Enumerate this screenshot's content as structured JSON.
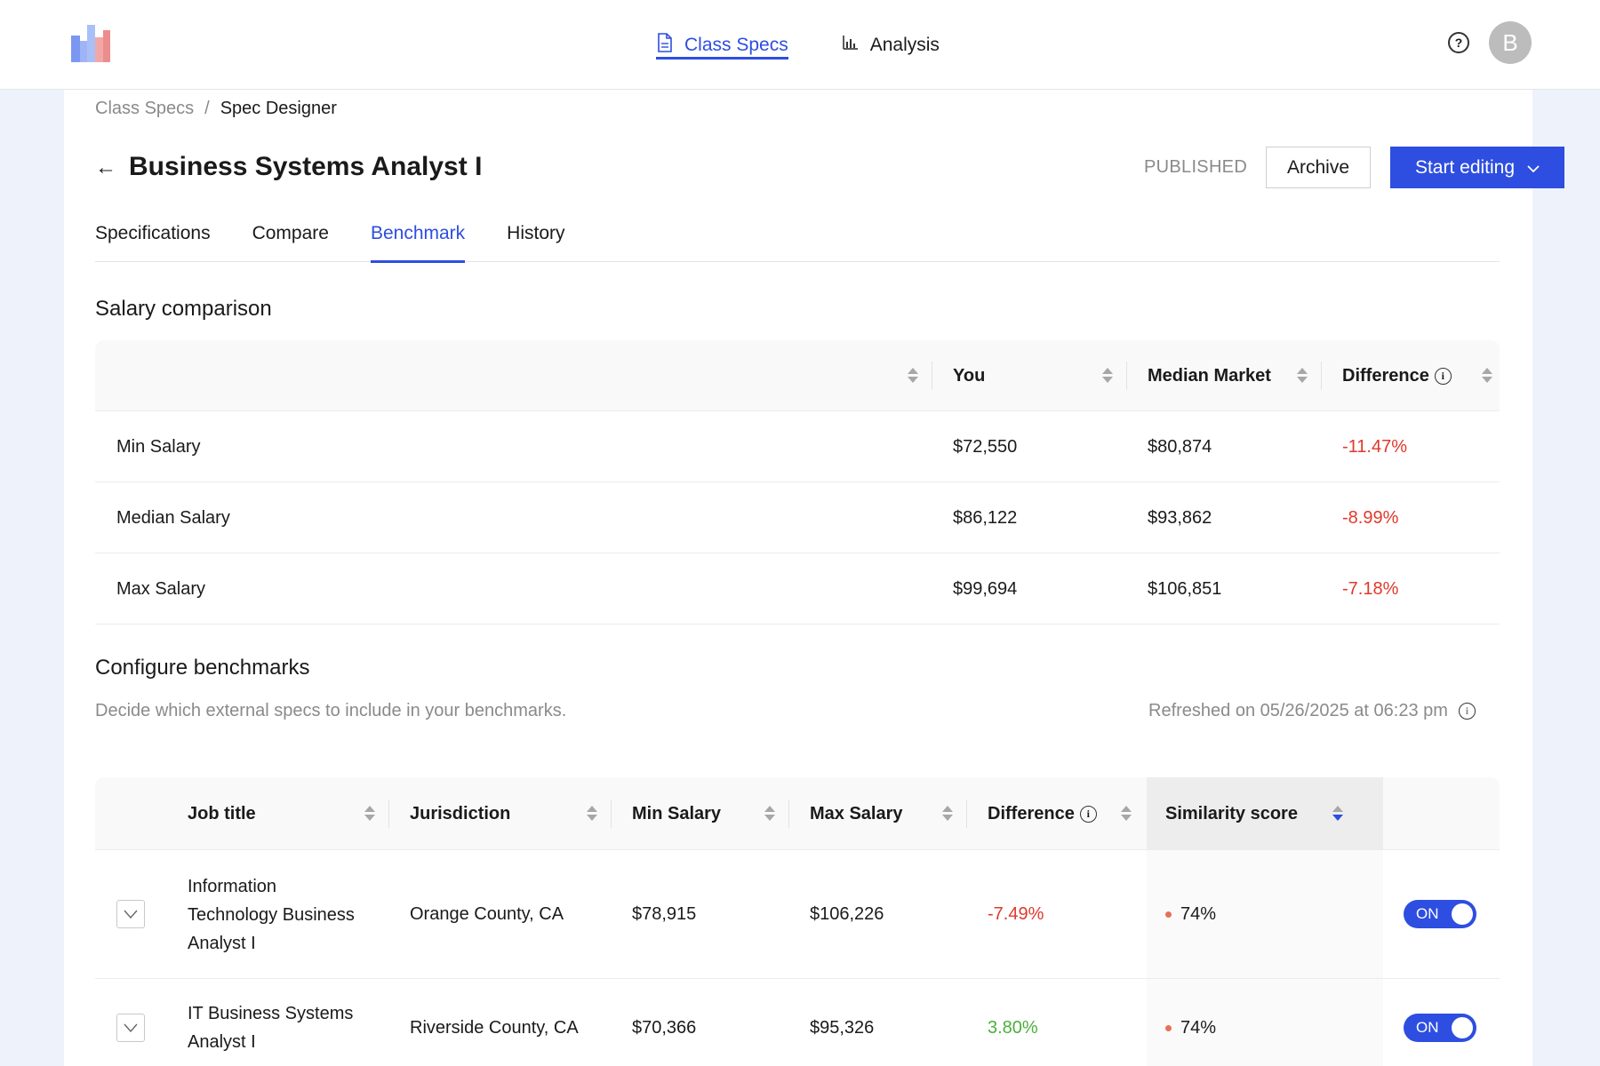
{
  "nav": {
    "items": [
      {
        "label": "Class Specs",
        "icon": "document-icon",
        "active": true
      },
      {
        "label": "Analysis",
        "icon": "bar-chart-icon",
        "active": false
      }
    ],
    "help_glyph": "?",
    "avatar_initial": "B"
  },
  "breadcrumb": {
    "parent": "Class Specs",
    "separator": "/",
    "current": "Spec Designer"
  },
  "header": {
    "back_glyph": "←",
    "title": "Business Systems Analyst I",
    "status": "PUBLISHED",
    "archive_label": "Archive",
    "edit_label": "Start editing"
  },
  "tabs": [
    {
      "label": "Specifications",
      "active": false
    },
    {
      "label": "Compare",
      "active": false
    },
    {
      "label": "Benchmark",
      "active": true
    },
    {
      "label": "History",
      "active": false
    }
  ],
  "salary": {
    "title": "Salary comparison",
    "columns": [
      "",
      "You",
      "Median Market",
      "Difference"
    ],
    "rows": [
      {
        "label": "Min Salary",
        "you": "$72,550",
        "market": "$80,874",
        "diff": "-11.47%"
      },
      {
        "label": "Median Salary",
        "you": "$86,122",
        "market": "$93,862",
        "diff": "-8.99%"
      },
      {
        "label": "Max Salary",
        "you": "$99,694",
        "market": "$106,851",
        "diff": "-7.18%"
      }
    ]
  },
  "benchmarks": {
    "title": "Configure benchmarks",
    "description": "Decide which external specs to include in your benchmarks.",
    "refreshed": "Refreshed on 05/26/2025 at 06:23 pm",
    "columns": [
      "Job title",
      "Jurisdiction",
      "Min Salary",
      "Max Salary",
      "Difference",
      "Similarity score"
    ],
    "rows": [
      {
        "title_lines": [
          "Information",
          "Technology Business",
          "Analyst I"
        ],
        "jurisdiction": "Orange County, CA",
        "min": "$78,915",
        "max": "$106,226",
        "diff": "-7.49%",
        "diff_sign": "neg",
        "score": "74%",
        "toggle": "ON"
      },
      {
        "title_lines": [
          "IT Business Systems",
          "Analyst I"
        ],
        "jurisdiction": "Riverside County, CA",
        "min": "$70,366",
        "max": "$95,326",
        "diff": "3.80%",
        "diff_sign": "pos",
        "score": "74%",
        "toggle": "ON"
      }
    ]
  },
  "colors": {
    "accent": "#2d4ee0",
    "negative": "#e0392b",
    "positive": "#4caf3c",
    "score_dot": "#e86f5b"
  }
}
